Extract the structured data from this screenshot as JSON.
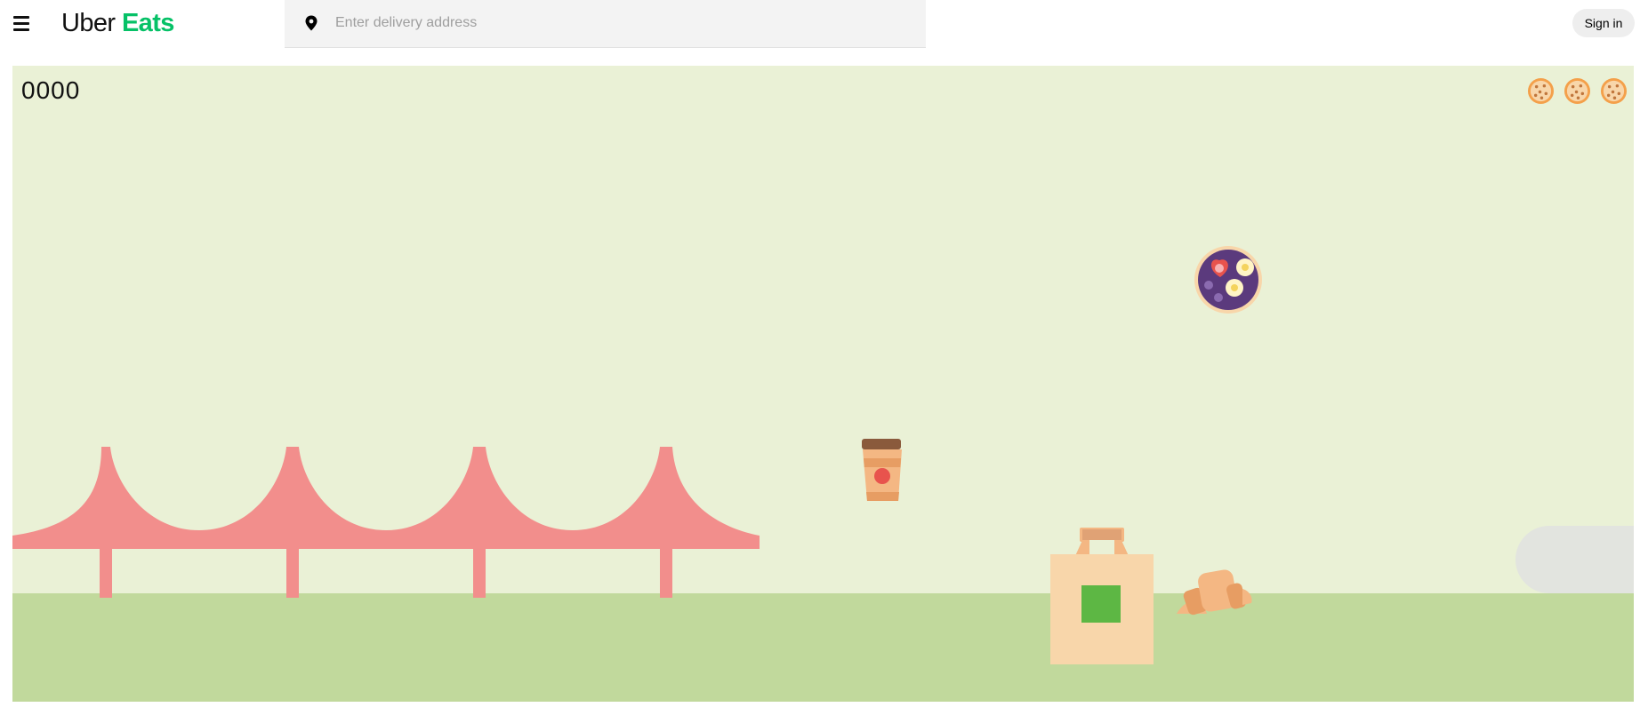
{
  "header": {
    "brand_part1": "Uber",
    "brand_part2": "Eats",
    "search": {
      "placeholder": "Enter delivery address",
      "value": ""
    },
    "sign_in_label": "Sign in",
    "icons": {
      "menu": "hamburger-menu-icon",
      "location": "location-pin-icon"
    }
  },
  "game": {
    "score": "0000",
    "lives": 3,
    "life_icon": "cookie-icon",
    "sprites": [
      "acai-bowl",
      "coffee-cup",
      "takeout-bag",
      "croissant",
      "bridge"
    ]
  },
  "colors": {
    "brand_green": "#06c167",
    "sky": "#eaf1d6",
    "ground": "#c1d99c",
    "bridge": "#f28e8c",
    "bag": "#f8d6aa",
    "bag_square": "#5db744",
    "bowl": "#5b3a7d",
    "cookie": "#f4a04a"
  }
}
